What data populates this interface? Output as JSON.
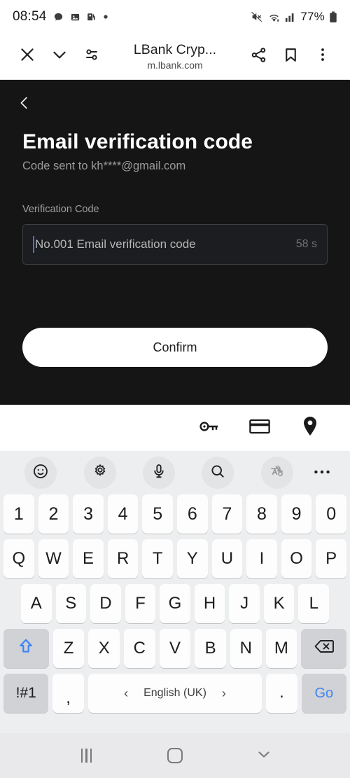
{
  "status_bar": {
    "time": "08:54",
    "battery": "77%",
    "left_icons": [
      "chat-bubble-icon",
      "image-icon",
      "gas-station-icon",
      "dot-icon"
    ],
    "right_icons": [
      "mute-icon",
      "wifi-icon",
      "signal-icon",
      "battery-icon"
    ]
  },
  "browser_toolbar": {
    "close_label": "close-icon",
    "collapse_label": "chevron-down-icon",
    "tune_label": "page-info-icon",
    "title": "LBank Cryp...",
    "url": "m.lbank.com",
    "share_label": "share-icon",
    "bookmark_label": "bookmark-icon",
    "more_label": "more-vertical-icon"
  },
  "page": {
    "back_icon": "chevron-left-icon",
    "heading": "Email verification code",
    "subtitle": "Code sent to kh****@gmail.com",
    "field_label": "Verification Code",
    "input_placeholder": "No.001 Email verification code",
    "input_value": "",
    "timer": "58 s",
    "confirm_label": "Confirm",
    "background_color": "#151515",
    "accent_color": "#3b74e8"
  },
  "autofill_bar": {
    "items": [
      {
        "name": "password-key-icon"
      },
      {
        "name": "credit-card-icon"
      },
      {
        "name": "location-pin-icon"
      }
    ]
  },
  "keyboard": {
    "toolbar": [
      {
        "name": "emoji-icon"
      },
      {
        "name": "settings-gear-icon"
      },
      {
        "name": "microphone-icon"
      },
      {
        "name": "search-icon"
      },
      {
        "name": "translate-icon"
      },
      {
        "name": "more-horizontal-icon"
      }
    ],
    "rows": {
      "numbers": [
        "1",
        "2",
        "3",
        "4",
        "5",
        "6",
        "7",
        "8",
        "9",
        "0"
      ],
      "top": [
        "Q",
        "W",
        "E",
        "R",
        "T",
        "Y",
        "U",
        "I",
        "O",
        "P"
      ],
      "home": [
        "A",
        "S",
        "D",
        "F",
        "G",
        "H",
        "J",
        "K",
        "L"
      ],
      "bottom": [
        "Z",
        "X",
        "C",
        "V",
        "B",
        "N",
        "M"
      ]
    },
    "shift_label": "shift-icon",
    "backspace_label": "backspace-icon",
    "symbols_label": "!#1",
    "comma_label": ",",
    "period_label": ".",
    "space_language": "English (UK)",
    "space_prev": "‹",
    "space_next": "›",
    "enter_label": "Go",
    "enter_color": "#4285f4",
    "key_color": "#fdfdfd",
    "fn_key_color": "#d0d2d6",
    "background_color": "#eceef0"
  },
  "nav_bar": {
    "recents_label": "recents-icon",
    "home_label": "home-icon",
    "dismiss_label": "hide-keyboard-chevron-icon"
  }
}
